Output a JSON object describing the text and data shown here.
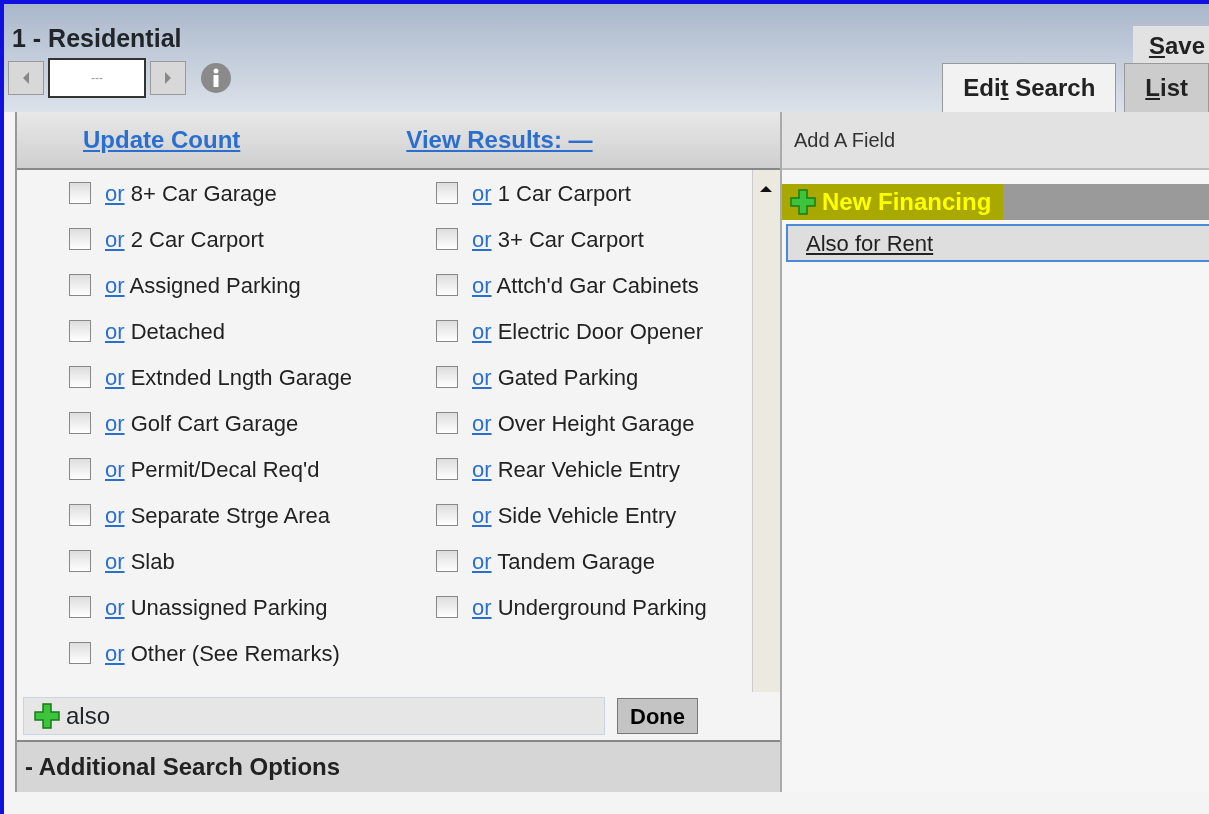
{
  "window": {
    "title": "1 - Residential"
  },
  "pager": {
    "value": "---"
  },
  "header_buttons": [
    {
      "key": "S",
      "after": "ave"
    }
  ],
  "tabs": [
    {
      "before": "Edi",
      "key": "t",
      "after": " Search",
      "selected": true
    },
    {
      "key": "L",
      "after": "ist",
      "selected": false
    }
  ],
  "toolbar": {
    "links": [
      "Update Count",
      "View Results: —"
    ]
  },
  "options": [
    {
      "or": "or",
      "label": "8+ Car Garage",
      "checked": false
    },
    {
      "or": "or",
      "label": "1 Car Carport",
      "checked": false
    },
    {
      "or": "or",
      "label": "2 Car Carport",
      "checked": false
    },
    {
      "or": "or",
      "label": "3+ Car Carport",
      "checked": false
    },
    {
      "or": "or",
      "label": "Assigned Parking",
      "checked": false
    },
    {
      "or": "or",
      "label": "Attch'd Gar Cabinets",
      "checked": false
    },
    {
      "or": "or",
      "label": "Detached",
      "checked": false
    },
    {
      "or": "or",
      "label": "Electric Door Opener",
      "checked": false
    },
    {
      "or": "or",
      "label": "Extnded Lngth Garage",
      "checked": false
    },
    {
      "or": "or",
      "label": "Gated Parking",
      "checked": false
    },
    {
      "or": "or",
      "label": "Golf Cart Garage",
      "checked": false
    },
    {
      "or": "or",
      "label": "Over Height Garage",
      "checked": false
    },
    {
      "or": "or",
      "label": "Permit/Decal Req'd",
      "checked": false
    },
    {
      "or": "or",
      "label": "Rear Vehicle Entry",
      "checked": false
    },
    {
      "or": "or",
      "label": "Separate Strge Area",
      "checked": false
    },
    {
      "or": "or",
      "label": "Side Vehicle Entry",
      "checked": false
    },
    {
      "or": "or",
      "label": "Slab",
      "checked": false
    },
    {
      "or": "or",
      "label": "Tandem Garage",
      "checked": false
    },
    {
      "or": "or",
      "label": "Unassigned Parking",
      "checked": false
    },
    {
      "or": "or",
      "label": "Underground Parking",
      "checked": false
    },
    {
      "or": "or",
      "label": "Other (See Remarks)",
      "checked": false
    }
  ],
  "also_row": {
    "label": "also",
    "button": "Done"
  },
  "section": {
    "label": "- Additional Search Options",
    "expanded": true
  },
  "add_field": {
    "title": "Add A Field",
    "items": [
      {
        "label": "New Financing",
        "kind": "highlighted"
      },
      {
        "label": "Also for Rent",
        "kind": "link"
      }
    ]
  }
}
